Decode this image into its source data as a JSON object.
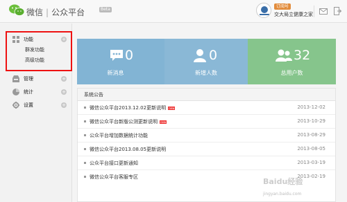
{
  "header": {
    "brand_left": "微信",
    "brand_right": "公众平台",
    "beta": "Beta",
    "account_badge": "订阅号",
    "account_name": "交大局立健康之家"
  },
  "sidebar": {
    "groups": [
      {
        "label": "功能",
        "subitems": [
          "群发功能",
          "高级功能"
        ]
      },
      {
        "label": "管理"
      },
      {
        "label": "统计"
      },
      {
        "label": "设置"
      }
    ]
  },
  "stats": [
    {
      "value": "0",
      "caption": "新消息"
    },
    {
      "value": "0",
      "caption": "新增人数"
    },
    {
      "value": "32",
      "caption": "总用户数"
    }
  ],
  "announcements": {
    "title": "系统公告",
    "items": [
      {
        "text": "微信公众平台2013.12.02更新说明",
        "is_new": true,
        "date": "2013-12-02"
      },
      {
        "text": "微信公众平台新版公测更新说明",
        "is_new": true,
        "date": "2013-10-29"
      },
      {
        "text": "公众平台增加数据统计功能",
        "is_new": false,
        "date": "2013-08-29"
      },
      {
        "text": "微信公众平台2013.08.05更新说明",
        "is_new": false,
        "date": "2013-08-05"
      },
      {
        "text": "公众平台接口更新通知",
        "is_new": false,
        "date": "2013-03-19"
      },
      {
        "text": "微信公众平台客服专区",
        "is_new": false,
        "date": "2013-02-19"
      }
    ],
    "new_label": "new"
  },
  "watermark": {
    "main": "Baidu经验",
    "sub": "jingyan.baidu.com"
  },
  "colors": {
    "stat_blue": "#82b4d4",
    "stat_green": "#86c58c",
    "highlight": "#e11"
  }
}
